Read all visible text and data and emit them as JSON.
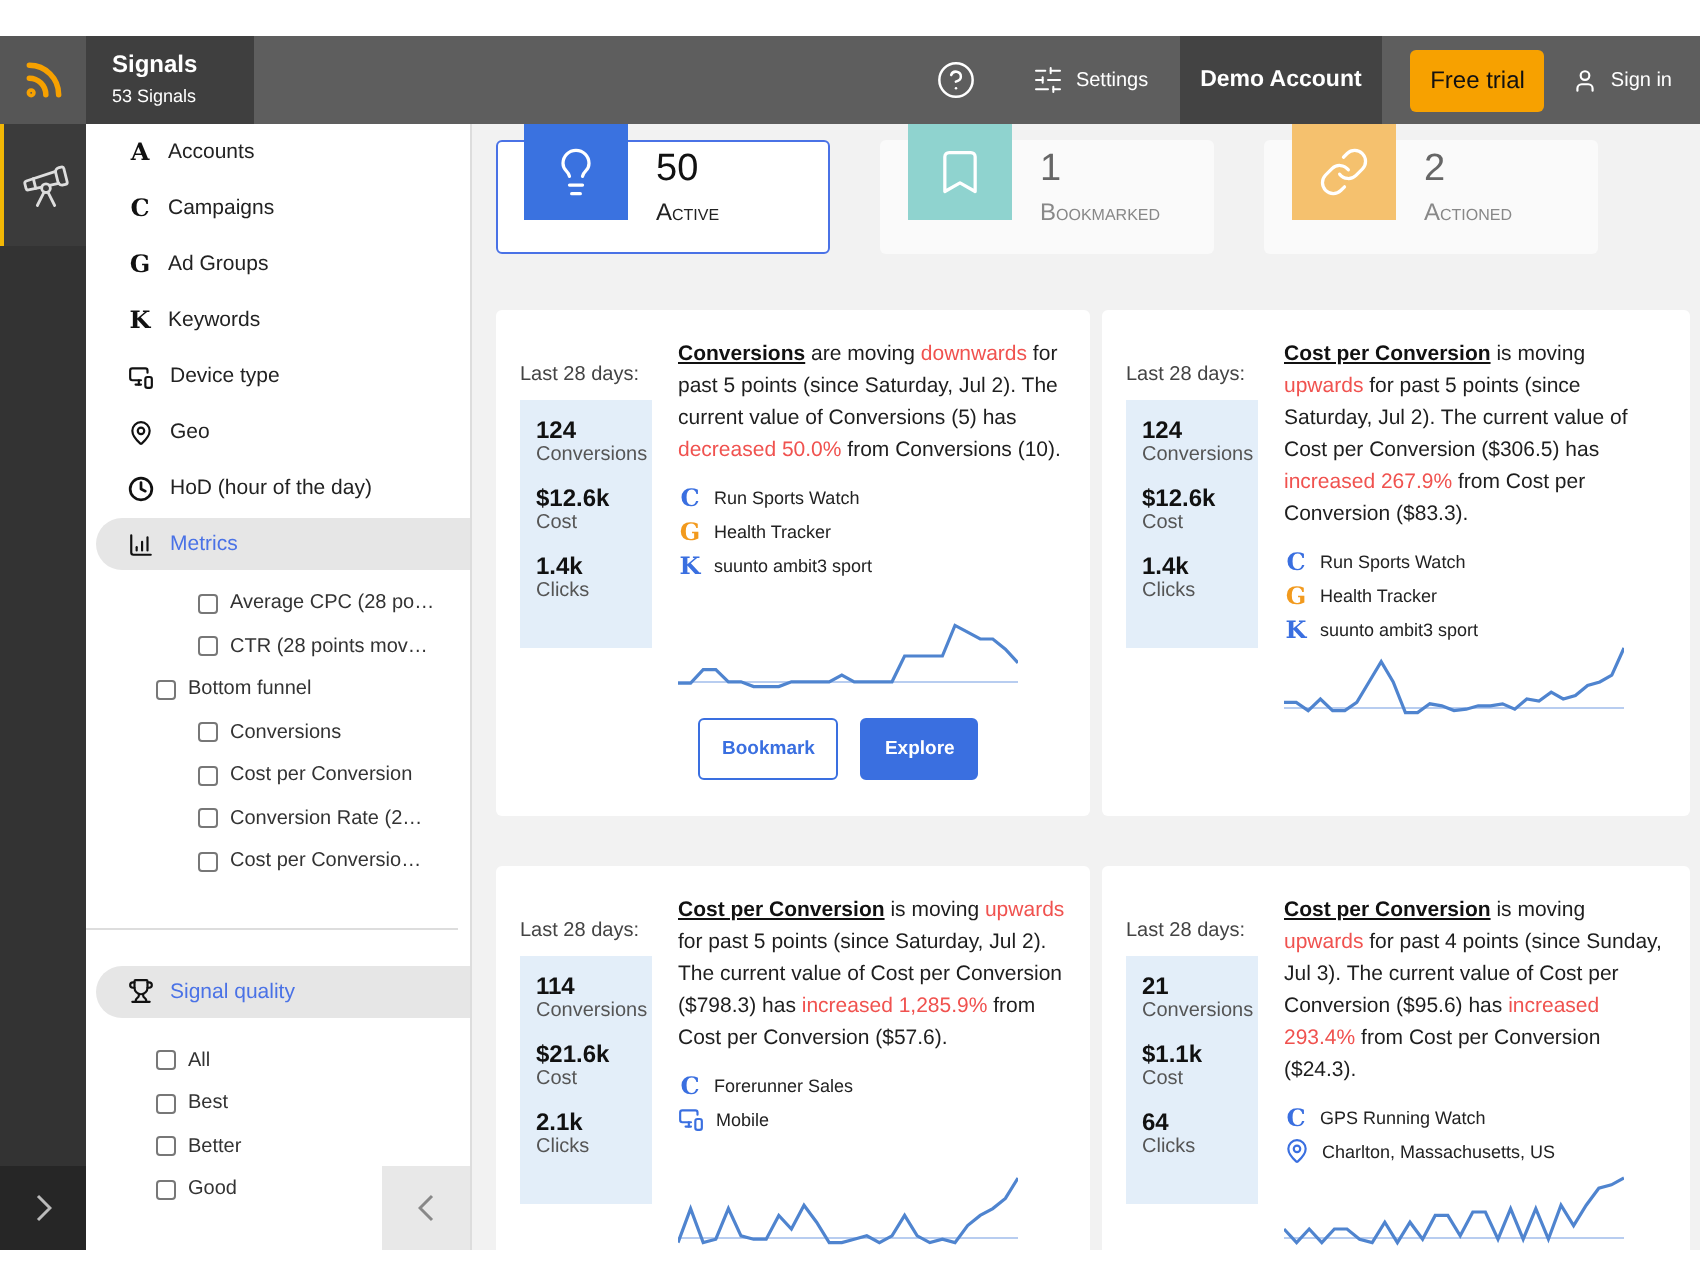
{
  "header": {
    "title": "Signals",
    "subtitle": "53 Signals",
    "settings": "Settings",
    "account": "Demo Account",
    "trial": "Free trial",
    "sign_in": "Sign in"
  },
  "sidebar": {
    "nav": [
      {
        "label": "Accounts",
        "glyph": "A",
        "selected": false
      },
      {
        "label": "Campaigns",
        "glyph": "C",
        "selected": false
      },
      {
        "label": "Ad Groups",
        "glyph": "G",
        "selected": false
      },
      {
        "label": "Keywords",
        "glyph": "K",
        "selected": false
      },
      {
        "label": "Device type",
        "selected": false
      },
      {
        "label": "Geo",
        "selected": false
      },
      {
        "label": "HoD (hour of the day)",
        "selected": false
      },
      {
        "label": "Metrics",
        "selected": true
      }
    ],
    "metric_groups": [
      {
        "children": [
          {
            "label": "Average CPC (28 po…",
            "checked": false
          },
          {
            "label": "CTR (28 points mov…",
            "checked": false
          }
        ]
      },
      {
        "label": "Bottom funnel",
        "checked": false,
        "children": [
          {
            "label": "Conversions",
            "checked": false
          },
          {
            "label": "Cost per Conversion",
            "checked": false
          },
          {
            "label": "Conversion Rate (2…",
            "checked": false
          },
          {
            "label": "Cost per Conversio…",
            "checked": false
          }
        ]
      }
    ],
    "quality": {
      "label": "Signal quality",
      "selected": true,
      "options": [
        {
          "label": "All",
          "checked": false
        },
        {
          "label": "Best",
          "checked": false
        },
        {
          "label": "Better",
          "checked": false
        },
        {
          "label": "Good",
          "checked": false
        }
      ]
    }
  },
  "stats": [
    {
      "count": "50",
      "label": "Active",
      "selected": true
    },
    {
      "count": "1",
      "label": "Bookmarked",
      "selected": false
    },
    {
      "count": "2",
      "label": "Actioned",
      "selected": false
    }
  ],
  "signals": [
    {
      "period": "Last 28 days:",
      "metrics": [
        {
          "value": "124",
          "label": "Conversions"
        },
        {
          "value": "$12.6k",
          "label": "Cost"
        },
        {
          "value": "1.4k",
          "label": "Clicks"
        }
      ],
      "summary": [
        {
          "kind": "metric",
          "text": "Conversions"
        },
        {
          "kind": "plain",
          "text": " are moving "
        },
        {
          "kind": "alert",
          "text": "downwards"
        },
        {
          "kind": "plain",
          "text": " for past 5 points (since Saturday, Jul 2). The current value of Conversions (5) has "
        },
        {
          "kind": "alert",
          "text": "decreased 50.0%"
        },
        {
          "kind": "plain",
          "text": " from Conversions (10)."
        }
      ],
      "entities": [
        {
          "glyph": "C",
          "color": "#3a6fe0",
          "label": "Run Sports Watch"
        },
        {
          "glyph": "G",
          "color": "#f29a1e",
          "label": "Health Tracker"
        },
        {
          "glyph": "K",
          "color": "#3a6fe0",
          "label": "suunto ambit3 sport"
        }
      ],
      "buttons": [
        {
          "kind": "outline",
          "label": "Bookmark"
        },
        {
          "kind": "primary",
          "label": "Explore"
        }
      ]
    },
    {
      "period": "Last 28 days:",
      "metrics": [
        {
          "value": "124",
          "label": "Conversions"
        },
        {
          "value": "$12.6k",
          "label": "Cost"
        },
        {
          "value": "1.4k",
          "label": "Clicks"
        }
      ],
      "summary": [
        {
          "kind": "metric",
          "text": "Cost per Conversion"
        },
        {
          "kind": "plain",
          "text": " is moving "
        },
        {
          "kind": "alert",
          "text": "upwards"
        },
        {
          "kind": "plain",
          "text": " for past 5 points (since Saturday, Jul 2). The current value of Cost per Conversion ($306.5) has "
        },
        {
          "kind": "alert",
          "text": "increased 267.9%"
        },
        {
          "kind": "plain",
          "text": " from Cost per Conversion ($83.3)."
        }
      ],
      "entities": [
        {
          "glyph": "C",
          "color": "#3a6fe0",
          "label": "Run Sports Watch"
        },
        {
          "glyph": "G",
          "color": "#f29a1e",
          "label": "Health Tracker"
        },
        {
          "glyph": "K",
          "color": "#3a6fe0",
          "label": "suunto ambit3 sport"
        }
      ]
    },
    {
      "period": "Last 28 days:",
      "metrics": [
        {
          "value": "114",
          "label": "Conversions"
        },
        {
          "value": "$21.6k",
          "label": "Cost"
        },
        {
          "value": "2.1k",
          "label": "Clicks"
        }
      ],
      "summary": [
        {
          "kind": "metric",
          "text": "Cost per Conversion"
        },
        {
          "kind": "plain",
          "text": " is moving "
        },
        {
          "kind": "alert",
          "text": "upwards"
        },
        {
          "kind": "plain",
          "text": " for past 5 points (since Saturday, Jul 2). The current value of Cost per Conversion ($798.3) has "
        },
        {
          "kind": "alert",
          "text": "increased 1,285.9%"
        },
        {
          "kind": "plain",
          "text": " from Cost per Conversion ($57.6)."
        }
      ],
      "entities": [
        {
          "glyph": "C",
          "color": "#3a6fe0",
          "label": "Forerunner Sales"
        },
        {
          "color": "#3a6fe0",
          "label": "Mobile"
        }
      ]
    },
    {
      "period": "Last 28 days:",
      "metrics": [
        {
          "value": "21",
          "label": "Conversions"
        },
        {
          "value": "$1.1k",
          "label": "Cost"
        },
        {
          "value": "64",
          "label": "Clicks"
        }
      ],
      "summary": [
        {
          "kind": "metric",
          "text": "Cost per Conversion"
        },
        {
          "kind": "plain",
          "text": " is moving "
        },
        {
          "kind": "alert",
          "text": "upwards"
        },
        {
          "kind": "plain",
          "text": " for past 4 points (since Sunday, Jul 3). The current value of Cost per Conversion ($95.6) has "
        },
        {
          "kind": "alert",
          "text": "increased 293.4%"
        },
        {
          "kind": "plain",
          "text": " from Cost per Conversion ($24.3)."
        }
      ],
      "entities": [
        {
          "glyph": "C",
          "color": "#3a6fe0",
          "label": "GPS Running Watch"
        },
        {
          "color": "#3a6fe0",
          "label": "Charlton, Massachusetts, US"
        }
      ]
    }
  ]
}
